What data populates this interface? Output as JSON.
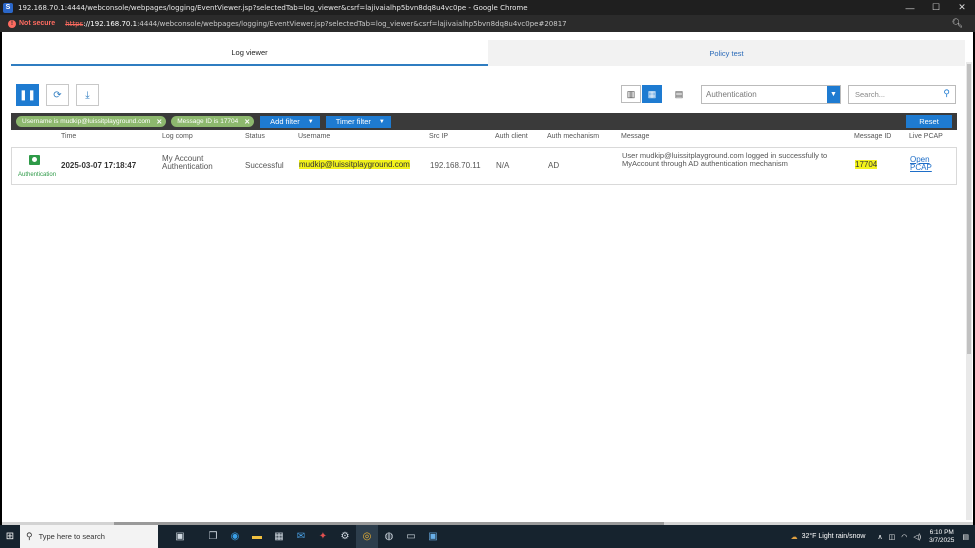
{
  "browser": {
    "window_title": "192.168.70.1:4444/webconsole/webpages/logging/EventViewer.jsp?selectedTab=log_viewer&csrf=lajivaialhp5bvn8dq8u4vc0pe - Google Chrome",
    "security_label": "Not secure",
    "url_proto": "https",
    "url_host": "://192.168.70.1",
    "url_rest": ":4444/webconsole/webpages/logging/EventViewer.jsp?selectedTab=log_viewer&csrf=lajivaialhp5bvn8dq8u4vc0pe#20817"
  },
  "tabs": [
    {
      "label": "Log viewer",
      "active": true
    },
    {
      "label": "Policy test",
      "active": false
    }
  ],
  "toolbar": {
    "log_type_value": "Authentication",
    "search_placeholder": "Search..."
  },
  "filters": {
    "chips": [
      {
        "label": "Username is mudkip@luissitplayground.com"
      },
      {
        "label": "Message ID is 17704"
      }
    ],
    "add_filter_label": "Add filter",
    "timer_filter_label": "Timer filter",
    "reset_label": "Reset"
  },
  "table": {
    "headers": [
      "Time",
      "Log comp",
      "Status",
      "Username",
      "Src IP",
      "Auth client",
      "Auth mechanism",
      "Message",
      "Message ID",
      "Live PCAP"
    ],
    "rows": [
      {
        "type": "Authentication",
        "time": "2025-03-07 17:18:47",
        "log_comp": "My Account Authentication",
        "status": "Successful",
        "username": "mudkip@luissitplayground.com",
        "src_ip": "192.168.70.11",
        "auth_client": "N/A",
        "auth_mechanism": "AD",
        "message": "User mudkip@luissitplayground.com logged in successfully to MyAccount through AD authentication mechanism",
        "message_id": "17704",
        "live_pcap": "Open PCAP"
      }
    ]
  },
  "taskbar": {
    "search_placeholder": "Type here to search",
    "weather": "32°F  Light rain/snow",
    "time": "6:10 PM",
    "date": "3/7/2025"
  }
}
